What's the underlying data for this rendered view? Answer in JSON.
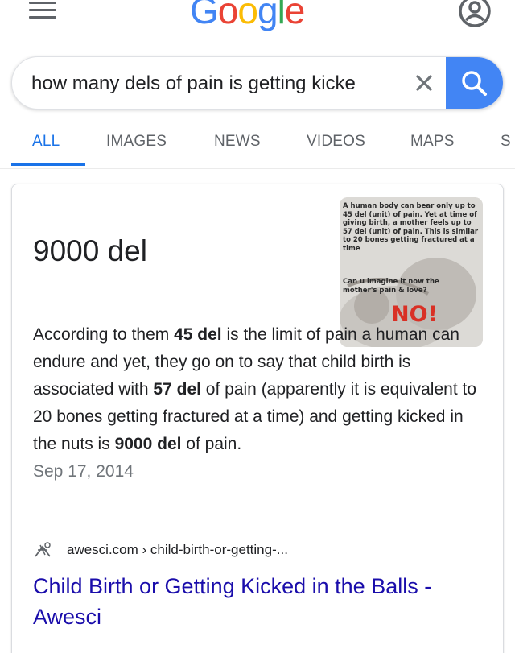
{
  "header": {
    "logo_text": "Google",
    "logo_colors": [
      "#4285f4",
      "#ea4335",
      "#fbbc05",
      "#4285f4",
      "#34a853",
      "#ea4335"
    ]
  },
  "search": {
    "query": "how many dels of pain is getting kicke"
  },
  "tabs": [
    {
      "label": "ALL",
      "active": true
    },
    {
      "label": "IMAGES"
    },
    {
      "label": "NEWS"
    },
    {
      "label": "VIDEOS"
    },
    {
      "label": "MAPS"
    },
    {
      "label": "S"
    }
  ],
  "featured": {
    "answer": "9000 del",
    "snippet": {
      "p1": "According to them ",
      "b1": "45 del",
      "p2": " is the limit of pain a human can endure and yet, they go on to say that child birth is associated with ",
      "b2": "57 del",
      "p3": " of pain (apparently it is equivalent to 20 bones getting fractured at a time) and getting kicked in the nuts is ",
      "b3": "9000 del",
      "p4": " of pain.",
      "date": "Sep 17, 2014"
    },
    "thumbnail": {
      "text_top": "A human body can bear only up to 45 del (unit) of pain. Yet at time of giving birth, a mother feels up to 57 del (unit) of pain. This is similar to 20 bones getting fractured at a time",
      "text_mid": "Can u imagine it now the mother's pain & love?",
      "text_no": "NO!"
    },
    "source": {
      "domain": "awesci.com",
      "path": " › child-birth-or-getting-..."
    },
    "result_title": "Child Birth or Getting Kicked in the Balls - Awesci"
  },
  "colors": {
    "accent": "#1a73e8",
    "search_button": "#4285f4",
    "link": "#1a0dab"
  }
}
